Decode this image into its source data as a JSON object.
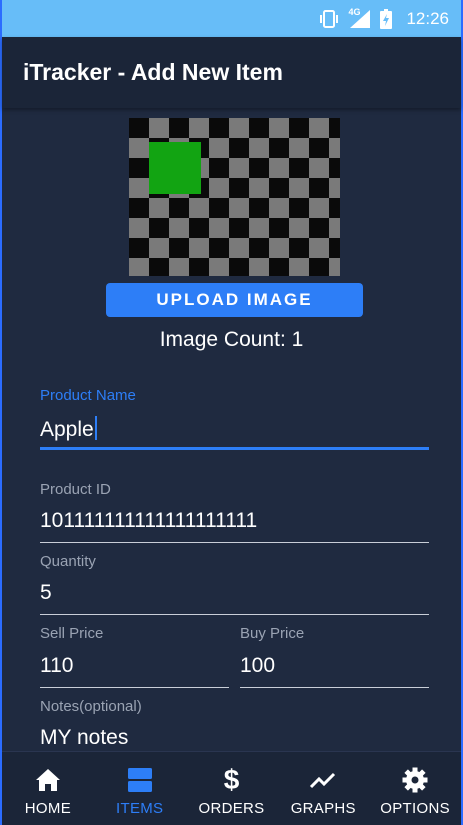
{
  "status_bar": {
    "network": "4G",
    "time": "12:26"
  },
  "app_bar": {
    "title": "iTracker - Add New Item"
  },
  "image_section": {
    "upload_label": "UPLOAD IMAGE",
    "image_count": "Image Count: 1"
  },
  "form": {
    "product_name": {
      "label": "Product Name",
      "value": "Apple"
    },
    "product_id": {
      "label": "Product ID",
      "value": "101111111111111111111"
    },
    "quantity": {
      "label": "Quantity",
      "value": "5"
    },
    "sell_price": {
      "label": "Sell Price",
      "value": "110"
    },
    "buy_price": {
      "label": "Buy Price",
      "value": "100"
    },
    "notes": {
      "label": "Notes(optional)",
      "value": "MY notes"
    }
  },
  "nav": {
    "items": [
      {
        "label": "HOME",
        "icon": "home-icon"
      },
      {
        "label": "ITEMS",
        "icon": "items-icon"
      },
      {
        "label": "ORDERS",
        "icon": "dollar-icon"
      },
      {
        "label": "GRAPHS",
        "icon": "trending-icon"
      },
      {
        "label": "OPTIONS",
        "icon": "gear-icon"
      }
    ],
    "active": "ITEMS"
  },
  "colors": {
    "accent": "#2d7ef7",
    "background": "#1f2a40",
    "status_bar": "#67bdf8"
  }
}
